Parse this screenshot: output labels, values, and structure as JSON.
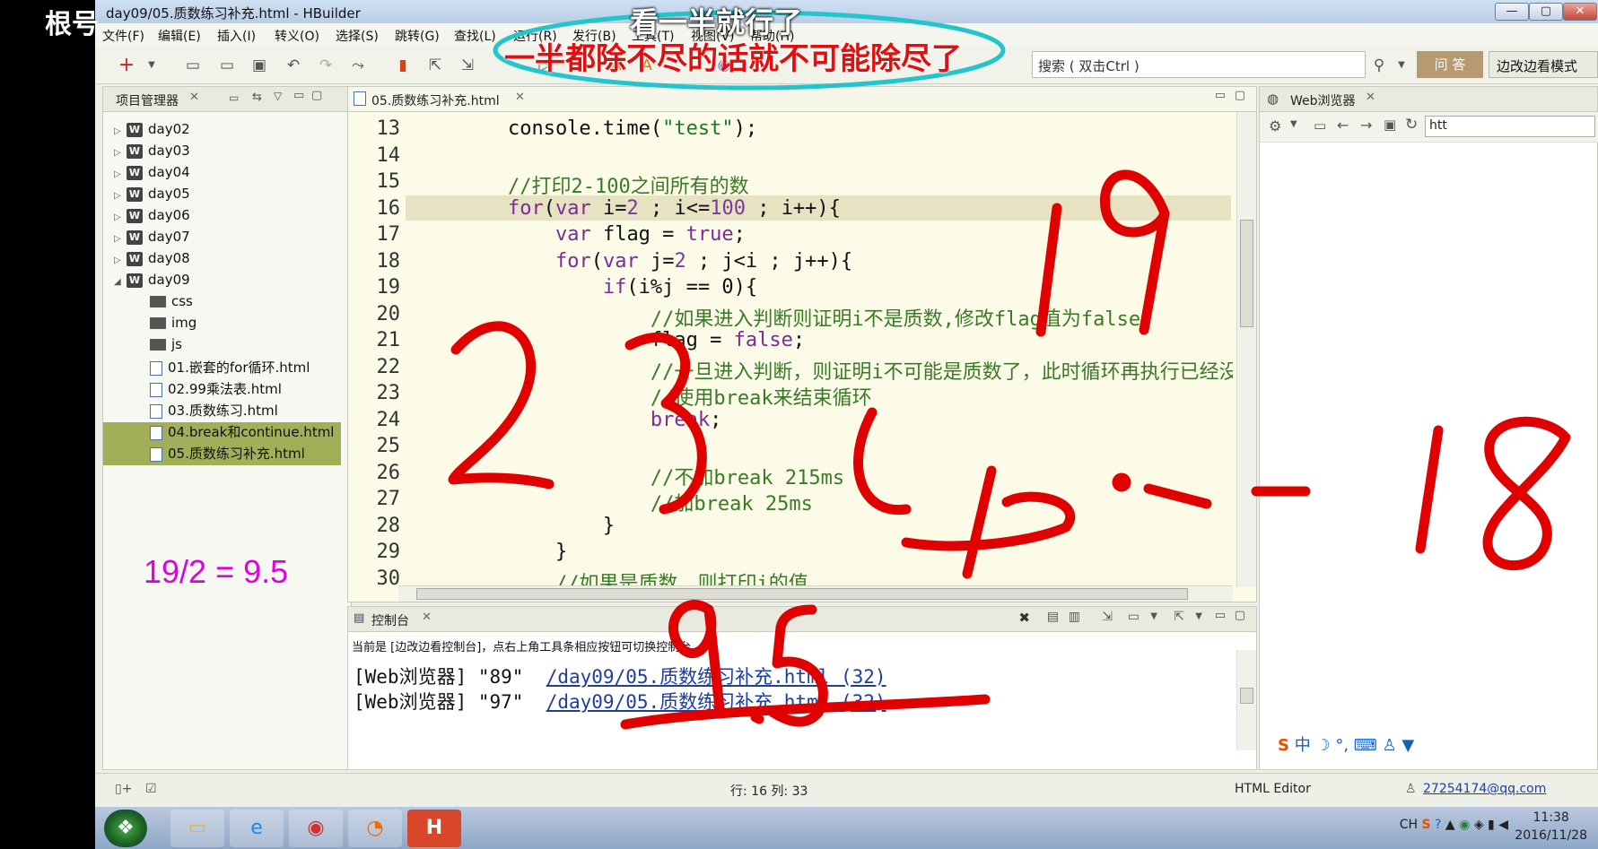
{
  "title": "day09/05.质数练习补充.html - HBuilder",
  "overlay": {
    "corner_label": "根号",
    "subtitle_top": "看一半就行了",
    "subtitle_bottom": "一半都除不尽的话就不可能除尽了",
    "math_note": "19/2 = 9.5",
    "handwritten": [
      "19",
      "2",
      "3",
      "4 ... 18",
      "9.5"
    ],
    "ink_color": "#e00000",
    "ellipse_color": "#22c5cc"
  },
  "window_controls": [
    "—",
    "▢",
    "✕"
  ],
  "menu": [
    "文件(F)",
    "编辑(E)",
    "插入(I)",
    "转义(O)",
    "选择(S)",
    "跳转(G)",
    "查找(L)",
    "运行(R)",
    "发行(B)",
    "工具(T)",
    "视图(V)",
    "帮助(H)"
  ],
  "toolbar": {
    "search_placeholder": "搜索 ( 双击Ctrl )",
    "qa_label": "问 答",
    "mode_label": "边改边看模式"
  },
  "project": {
    "tab_label": "项目管理器",
    "items": [
      {
        "label": "day02",
        "kind": "project"
      },
      {
        "label": "day03",
        "kind": "project"
      },
      {
        "label": "day04",
        "kind": "project"
      },
      {
        "label": "day05",
        "kind": "project"
      },
      {
        "label": "day06",
        "kind": "project"
      },
      {
        "label": "day07",
        "kind": "project"
      },
      {
        "label": "day08",
        "kind": "project"
      },
      {
        "label": "day09",
        "kind": "project-open"
      },
      {
        "label": "css",
        "kind": "folder"
      },
      {
        "label": "img",
        "kind": "folder"
      },
      {
        "label": "js",
        "kind": "folder"
      },
      {
        "label": "01.嵌套的for循环.html",
        "kind": "file"
      },
      {
        "label": "02.99乘法表.html",
        "kind": "file"
      },
      {
        "label": "03.质数练习.html",
        "kind": "file"
      },
      {
        "label": "04.break和continue.html",
        "kind": "file-selected"
      },
      {
        "label": "05.质数练习补充.html",
        "kind": "file-selected"
      }
    ]
  },
  "editor": {
    "tab_label": "05.质数练习补充.html",
    "current_line": "16",
    "lines": [
      {
        "n": "13",
        "code": "        console.time(\"test\");"
      },
      {
        "n": "14",
        "code": ""
      },
      {
        "n": "15",
        "code": "        //打印2-100之间所有的数"
      },
      {
        "n": "16",
        "code": "        for(var i=2 ; i<=100 ; i++){"
      },
      {
        "n": "17",
        "code": "            var flag = true;"
      },
      {
        "n": "18",
        "code": "            for(var j=2 ; j<i ; j++){"
      },
      {
        "n": "19",
        "code": "                if(i%j == 0){"
      },
      {
        "n": "20",
        "code": "                    //如果进入判断则证明i不是质数,修改flag值为false"
      },
      {
        "n": "21",
        "code": "                    flag = false;"
      },
      {
        "n": "22",
        "code": "                    //一旦进入判断，则证明i不可能是质数了，此时循环再执行已经没有任何意义了"
      },
      {
        "n": "23",
        "code": "                    //使用break来结束循环"
      },
      {
        "n": "24",
        "code": "                    break;"
      },
      {
        "n": "25",
        "code": ""
      },
      {
        "n": "26",
        "code": "                    //不加break 215ms"
      },
      {
        "n": "27",
        "code": "                    //加break 25ms"
      },
      {
        "n": "28",
        "code": "                }"
      },
      {
        "n": "29",
        "code": "            }"
      },
      {
        "n": "30",
        "code": "            //如果是质数，则打印i的值"
      }
    ]
  },
  "browser": {
    "tab_label": "Web浏览器",
    "url_stub": "htt"
  },
  "console": {
    "tab_label": "控制台",
    "note": "当前是 [边改边看控制台]，点右上角工具条相应按钮可切换控制台",
    "lines": [
      {
        "prefix": "[Web浏览器] \"89\"  ",
        "link": "/day09/05.质数练习补充.html (32)"
      },
      {
        "prefix": "[Web浏览器] \"97\"  ",
        "link": "/day09/05.质数练习补充.html (32)"
      }
    ]
  },
  "status": {
    "position": "行: 16 列: 33",
    "editor_type": "HTML Editor",
    "user": "27254174@qq.com"
  },
  "clock": {
    "time": "11:38",
    "date": "2016/11/28"
  }
}
